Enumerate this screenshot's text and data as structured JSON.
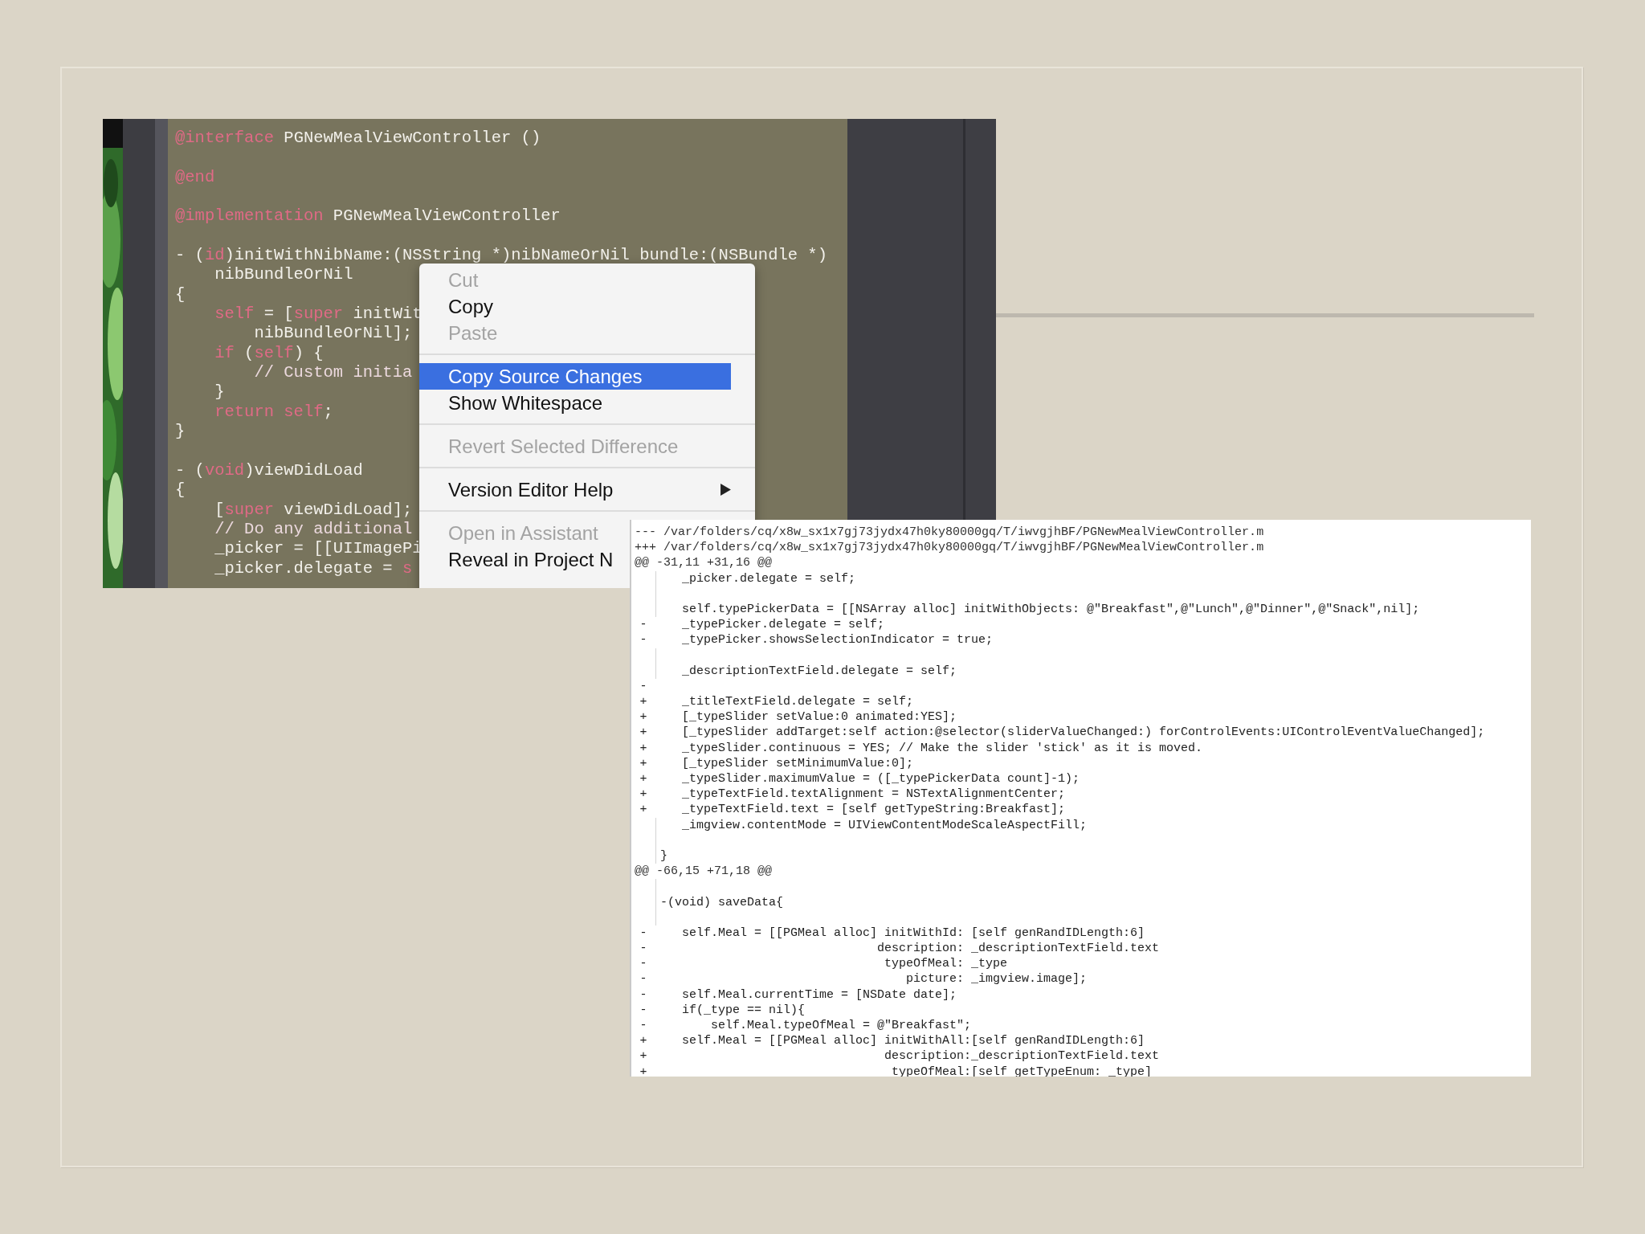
{
  "editor": {
    "lines": [
      {
        "kind": "code",
        "segments": [
          {
            "kind": "keyword",
            "text": "@interface"
          },
          {
            "kind": "plain",
            "text": " PGNewMealViewController ()"
          }
        ]
      },
      {
        "kind": "blank"
      },
      {
        "kind": "code",
        "segments": [
          {
            "kind": "keyword",
            "text": "@end"
          }
        ]
      },
      {
        "kind": "blank"
      },
      {
        "kind": "code",
        "segments": [
          {
            "kind": "keyword",
            "text": "@implementation"
          },
          {
            "kind": "plain",
            "text": " PGNewMealViewController"
          }
        ]
      },
      {
        "kind": "blank"
      },
      {
        "kind": "code",
        "segments": [
          {
            "kind": "plain",
            "text": "- ("
          },
          {
            "kind": "keyword",
            "text": "id"
          },
          {
            "kind": "plain",
            "text": ")initWithNibName:(NSString *)nibNameOrNil bundle:(NSBundle *)"
          }
        ]
      },
      {
        "kind": "code",
        "segments": [
          {
            "kind": "plain",
            "text": "    nibBundleOrNil"
          }
        ]
      },
      {
        "kind": "code",
        "segments": [
          {
            "kind": "plain",
            "text": "{"
          }
        ]
      },
      {
        "kind": "code",
        "segments": [
          {
            "kind": "keyword",
            "text": "    self"
          },
          {
            "kind": "plain",
            "text": " = ["
          },
          {
            "kind": "keyword",
            "text": "super"
          },
          {
            "kind": "plain",
            "text": " initWit"
          }
        ]
      },
      {
        "kind": "code",
        "segments": [
          {
            "kind": "plain",
            "text": "        nibBundleOrNil];"
          }
        ]
      },
      {
        "kind": "code",
        "segments": [
          {
            "kind": "keyword",
            "text": "    if"
          },
          {
            "kind": "plain",
            "text": " ("
          },
          {
            "kind": "keyword",
            "text": "self"
          },
          {
            "kind": "plain",
            "text": ") {"
          }
        ]
      },
      {
        "kind": "code",
        "segments": [
          {
            "kind": "comment",
            "text": "        // Custom initia"
          }
        ]
      },
      {
        "kind": "code",
        "segments": [
          {
            "kind": "plain",
            "text": "    }"
          }
        ]
      },
      {
        "kind": "code",
        "segments": [
          {
            "kind": "keyword",
            "text": "    return self"
          },
          {
            "kind": "plain",
            "text": ";"
          }
        ]
      },
      {
        "kind": "code",
        "segments": [
          {
            "kind": "plain",
            "text": "}"
          }
        ]
      },
      {
        "kind": "blank"
      },
      {
        "kind": "code",
        "segments": [
          {
            "kind": "plain",
            "text": "- ("
          },
          {
            "kind": "keyword",
            "text": "void"
          },
          {
            "kind": "plain",
            "text": ")viewDidLoad"
          }
        ]
      },
      {
        "kind": "code",
        "segments": [
          {
            "kind": "plain",
            "text": "{"
          }
        ]
      },
      {
        "kind": "code",
        "segments": [
          {
            "kind": "plain",
            "text": "    ["
          },
          {
            "kind": "keyword",
            "text": "super"
          },
          {
            "kind": "plain",
            "text": " viewDidLoad];"
          }
        ]
      },
      {
        "kind": "code",
        "segments": [
          {
            "kind": "comment",
            "text": "    // Do any additional"
          }
        ]
      },
      {
        "kind": "code",
        "segments": [
          {
            "kind": "plain",
            "text": "    _picker = [[UIImagePi"
          }
        ]
      },
      {
        "kind": "code",
        "segments": [
          {
            "kind": "plain",
            "text": "    _picker.delegate = "
          },
          {
            "kind": "keyword",
            "text": "s"
          }
        ]
      }
    ]
  },
  "context_menu": {
    "items": [
      {
        "kind": "item",
        "label": "Cut",
        "disabled": true,
        "selected": false
      },
      {
        "kind": "item",
        "label": "Copy",
        "disabled": false,
        "selected": false
      },
      {
        "kind": "item",
        "label": "Paste",
        "disabled": true,
        "selected": false
      },
      {
        "kind": "separator"
      },
      {
        "kind": "item",
        "label": "Copy Source Changes",
        "disabled": false,
        "selected": true
      },
      {
        "kind": "item",
        "label": "Show Whitespace",
        "disabled": false,
        "selected": false
      },
      {
        "kind": "separator"
      },
      {
        "kind": "item",
        "label": "Revert Selected Difference",
        "disabled": true,
        "selected": false
      },
      {
        "kind": "separator"
      },
      {
        "kind": "item",
        "label": "Version Editor Help",
        "disabled": false,
        "selected": false,
        "submenu": true
      },
      {
        "kind": "separator"
      },
      {
        "kind": "item",
        "label": "Open in Assistant",
        "disabled": true,
        "selected": false
      },
      {
        "kind": "item",
        "label": "Reveal in Project N",
        "disabled": false,
        "selected": false
      }
    ]
  },
  "diff": {
    "lines": [
      {
        "kind": "header",
        "text": "--- /var/folders/cq/x8w_sx1x7gj73jydx47h0ky80000gq/T/iwvgjhBF/PGNewMealViewController.m"
      },
      {
        "kind": "header",
        "text": "+++ /var/folders/cq/x8w_sx1x7gj73jydx47h0ky80000gq/T/iwvgjhBF/PGNewMealViewController.m"
      },
      {
        "kind": "header",
        "text": "@@ -31,11 +31,16 @@"
      },
      {
        "kind": "context",
        "text": "   _picker.delegate = self;"
      },
      {
        "kind": "blank"
      },
      {
        "kind": "context",
        "text": "   self.typePickerData = [[NSArray alloc] initWithObjects: @\"Breakfast\",@\"Lunch\",@\"Dinner\",@\"Snack\",nil];"
      },
      {
        "kind": "removed",
        "mark": "-",
        "text": "   _typePicker.delegate = self;"
      },
      {
        "kind": "removed",
        "mark": "-",
        "text": "   _typePicker.showsSelectionIndicator = true;"
      },
      {
        "kind": "blank"
      },
      {
        "kind": "context",
        "text": "   _descriptionTextField.delegate = self;"
      },
      {
        "kind": "removed",
        "mark": "-"
      },
      {
        "kind": "added",
        "mark": "+",
        "text": "   _titleTextField.delegate = self;"
      },
      {
        "kind": "added",
        "mark": "+",
        "text": "   [_typeSlider setValue:0 animated:YES];"
      },
      {
        "kind": "added",
        "mark": "+",
        "text": "   [_typeSlider addTarget:self action:@selector(sliderValueChanged:) forControlEvents:UIControlEventValueChanged];"
      },
      {
        "kind": "added",
        "mark": "+",
        "text": "   _typeSlider.continuous = YES; // Make the slider 'stick' as it is moved."
      },
      {
        "kind": "added",
        "mark": "+",
        "text": "   [_typeSlider setMinimumValue:0];"
      },
      {
        "kind": "added",
        "mark": "+",
        "text": "   _typeSlider.maximumValue = ([_typePickerData count]-1);"
      },
      {
        "kind": "added",
        "mark": "+",
        "text": "   _typeTextField.textAlignment = NSTextAlignmentCenter;"
      },
      {
        "kind": "added",
        "mark": "+",
        "text": "   _typeTextField.text = [self getTypeString:Breakfast];"
      },
      {
        "kind": "context",
        "text": "   _imgview.contentMode = UIViewContentModeScaleAspectFill;"
      },
      {
        "kind": "blank"
      },
      {
        "kind": "context",
        "text": "}"
      },
      {
        "kind": "header",
        "text": "@@ -66,15 +71,18 @@"
      },
      {
        "kind": "blank"
      },
      {
        "kind": "context",
        "text": "-(void) saveData{"
      },
      {
        "kind": "blank"
      },
      {
        "kind": "removed",
        "mark": "-",
        "text": "   self.Meal = [[PGMeal alloc] initWithId: [self genRandIDLength:6]"
      },
      {
        "kind": "removed",
        "mark": "-",
        "text": "                              description: _descriptionTextField.text"
      },
      {
        "kind": "removed",
        "mark": "-",
        "text": "                               typeOfMeal: _type"
      },
      {
        "kind": "removed",
        "mark": "-",
        "text": "                                  picture: _imgview.image];"
      },
      {
        "kind": "removed",
        "mark": "-",
        "text": "   self.Meal.currentTime = [NSDate date];"
      },
      {
        "kind": "removed",
        "mark": "-",
        "text": "   if(_type == nil){"
      },
      {
        "kind": "removed",
        "mark": "-",
        "text": "       self.Meal.typeOfMeal = @\"Breakfast\";"
      },
      {
        "kind": "added",
        "mark": "+",
        "text": "   self.Meal = [[PGMeal alloc] initWithAll:[self genRandIDLength:6]"
      },
      {
        "kind": "added",
        "mark": "+",
        "text": "                               description:_descriptionTextField.text"
      },
      {
        "kind": "added",
        "mark": "+",
        "text": "                                typeOfMeal:[self getTypeEnum: _type]"
      }
    ]
  }
}
